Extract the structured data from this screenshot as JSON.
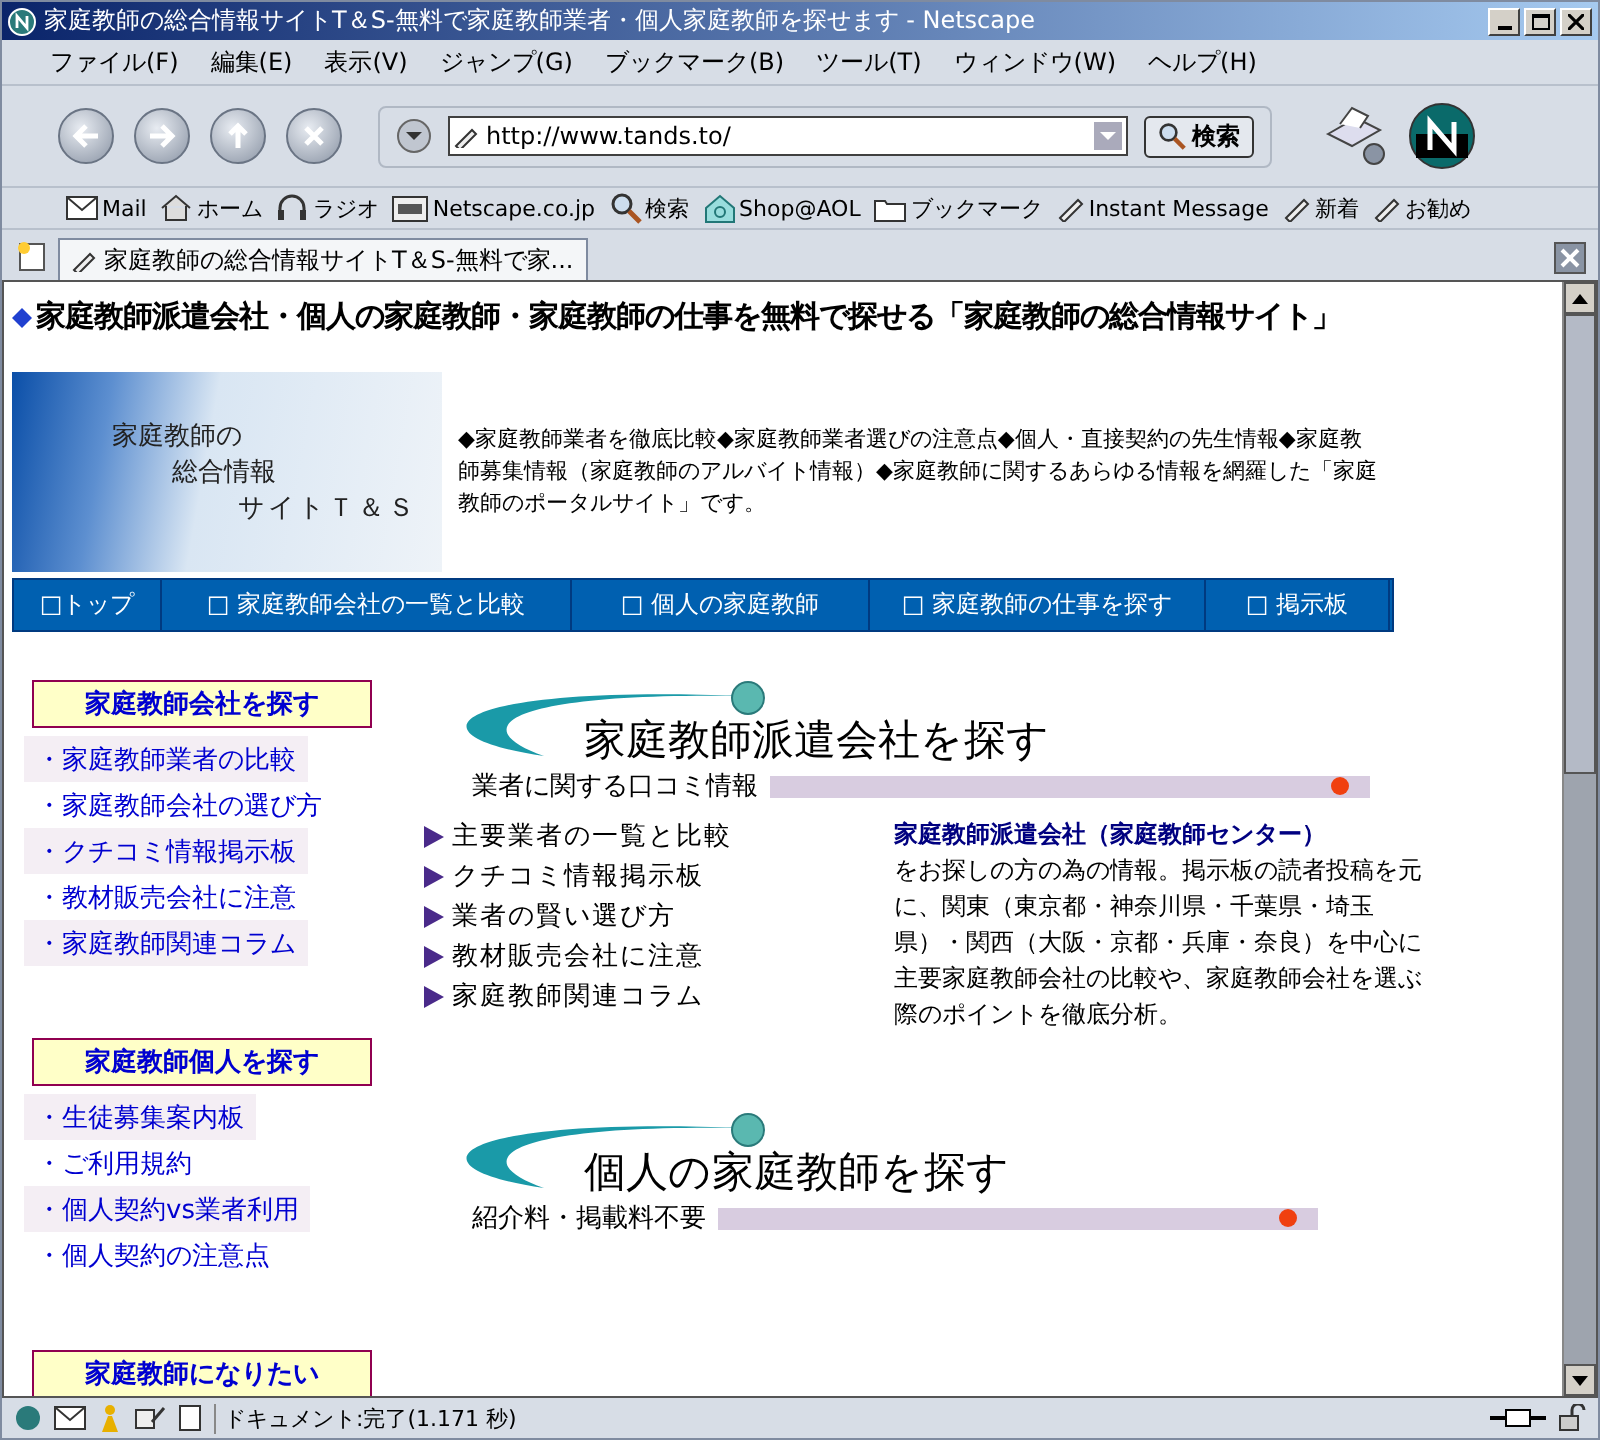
{
  "window": {
    "title": "家庭教師の総合情報サイトT＆S-無料で家庭教師業者・個人家庭教師を探せます - Netscape"
  },
  "menu": [
    "ファイル(F)",
    "編集(E)",
    "表示(V)",
    "ジャンプ(G)",
    "ブックマーク(B)",
    "ツール(T)",
    "ウィンドウ(W)",
    "ヘルプ(H)"
  ],
  "toolbar": {
    "url": "http://www.tands.to/",
    "search_button": "検索"
  },
  "personal_toolbar": [
    {
      "kind": "mail",
      "label": "Mail"
    },
    {
      "kind": "home",
      "label": "ホーム"
    },
    {
      "kind": "radio",
      "label": "ラジオ"
    },
    {
      "kind": "my",
      "label": "Netscape.co.jp"
    },
    {
      "kind": "search",
      "label": "検索"
    },
    {
      "kind": "shop",
      "label": "Shop@AOL"
    },
    {
      "kind": "folder",
      "label": "ブックマーク"
    },
    {
      "kind": "link",
      "label": "Instant Message"
    },
    {
      "kind": "link",
      "label": "新着"
    },
    {
      "kind": "link",
      "label": "お勧め"
    }
  ],
  "tab": {
    "title": "家庭教師の総合情報サイトT＆S-無料で家..."
  },
  "page": {
    "heading": "家庭教師派遣会社・個人の家庭教師・家庭教師の仕事を無料で探せる「家庭教師の総合情報サイト」",
    "banner_lines": [
      "家庭教師の",
      "総合情報",
      "サイトＴ＆Ｓ"
    ],
    "intro": "◆家庭教師業者を徹底比較◆家庭教師業者選びの注意点◆個人・直接契約の先生情報◆家庭教師募集情報（家庭教師のアルバイト情報）◆家庭教師に関するあらゆる情報を網羅した「家庭教師のポータルサイト」です。",
    "nav": [
      "□トップ",
      "□ 家庭教師会社の一覧と比較",
      "□ 個人の家庭教師",
      "□ 家庭教師の仕事を探す",
      "□ 掲示板"
    ],
    "sidebar": [
      {
        "title": "家庭教師会社を探す",
        "links": [
          "・家庭教師業者の比較",
          "・家庭教師会社の選び方",
          "・クチコミ情報掲示板",
          "・教材販売会社に注意",
          "・家庭教師関連コラム"
        ]
      },
      {
        "title": "家庭教師個人を探す",
        "links": [
          "・生徒募集案内板",
          "・ご利用規約",
          "・個人契約vs業者利用",
          "・個人契約の注意点"
        ]
      },
      {
        "title": "家庭教師になりたい"
      }
    ],
    "sections": [
      {
        "title": "家庭教師派遣会社を探す",
        "subtitle": "業者に関する口コミ情報",
        "links": [
          "主要業者の一覧と比較",
          "クチコミ情報掲示板",
          "業者の賢い選び方",
          "教材販売会社に注意",
          "家庭教師関連コラム"
        ],
        "feature_title": "家庭教師派遣会社（家庭教師センター）",
        "feature_text": "をお探しの方の為の情報。掲示板の読者投稿を元に、関東（東京都・神奈川県・千葉県・埼玉県）・関西（大阪・京都・兵庫・奈良）を中心に主要家庭教師会社の比較や、家庭教師会社を選ぶ際のポイントを徹底分析。"
      },
      {
        "title": "個人の家庭教師を探す",
        "subtitle": "紹介料・掲載料不要"
      }
    ]
  },
  "status": "ドキュメント:完了(1.171 秒)"
}
